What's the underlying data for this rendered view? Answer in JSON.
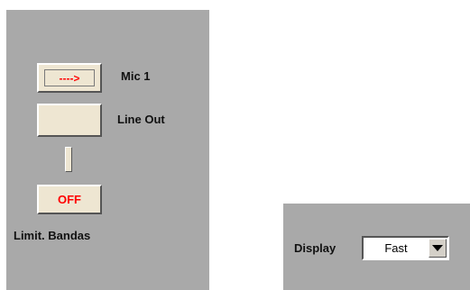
{
  "left_panel": {
    "mic_button_label": "---->",
    "mic_label": "Mic 1",
    "line_out_label": "Line Out",
    "off_button_label": "OFF",
    "limit_label": "Limit. Bandas"
  },
  "right_panel": {
    "display_label": "Display",
    "display_select_value": "Fast"
  },
  "colors": {
    "panel_bg": "#a9a9a9",
    "button_face": "#eee6d2",
    "accent_red": "#ff0000"
  }
}
